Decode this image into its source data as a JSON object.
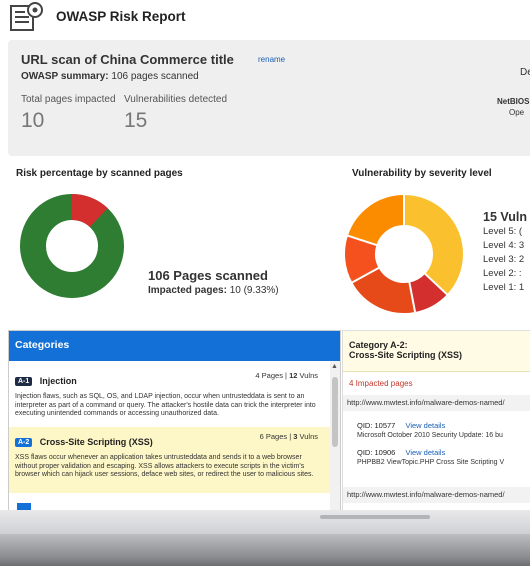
{
  "header": {
    "title": "OWASP Risk Report",
    "icon": "report-icon"
  },
  "scan": {
    "title": "URL scan of China Commerce title",
    "rename_label": "rename",
    "summary_label": "OWASP summary:",
    "summary_value": "106 pages scanned",
    "impacted_label": "Total pages impacted",
    "impacted_value": "10",
    "vuln_label": "Vulnerabilities detected",
    "vuln_value": "15",
    "right_frag_1": "De",
    "right_frag_2": "NetBIOS",
    "right_frag_3": "Ope"
  },
  "risk": {
    "title": "Risk percentage by scanned pages",
    "pages_scanned": "106 Pages scanned",
    "impacted_label": "Impacted pages:",
    "impacted_value": "10 (9.33%)",
    "donut": {
      "impacted_fraction": 0.0933,
      "impacted_color": "#d32f2f",
      "clean_color": "#2e7d32"
    }
  },
  "severity": {
    "title": "Vulnerability by severity level",
    "total_label": "15 Vuln",
    "levels": [
      "Level 5: (",
      "Level 4: 3",
      "Level 3: 2",
      "Level 2: :",
      "Level 1: 1"
    ],
    "colors": [
      "#d32f2f",
      "#e64a19",
      "#f4511e",
      "#fb8c00",
      "#fbc02d"
    ]
  },
  "categories": {
    "header": "Categories",
    "items": [
      {
        "badge": "A-1",
        "name": "Injection",
        "pages": "4",
        "pages_label": "Pages",
        "vulns": "12",
        "vulns_label": "Vulns",
        "desc": "Injection flaws, such as SQL, OS, and LDAP injection, occur when untrusteddata is sent to an interpreter as part of a command or query. The attacker's hostile data can trick the interpreter into executing unintended commands or accessing unauthorized data."
      },
      {
        "badge": "A-2",
        "name": "Cross-Site Scripting (XSS)",
        "pages": "6",
        "pages_label": "Pages",
        "vulns": "3",
        "vulns_label": "Vulns",
        "desc": "XSS flaws occur whenever an application takes untrusteddata and sends it to a web browser without proper validation and escaping. XSS allows attackers to execute scripts in the victim's browser which can hijack user sessions, deface web sites, or redirect the user to malicious sites."
      }
    ]
  },
  "detail": {
    "category": "Category A-2:",
    "name": "Cross-Site Scripting (XSS)",
    "impacted": "4 Impacted pages",
    "url1": "http://www.mwtest.info/malware-demos-named/",
    "qid1": "QID: 10577",
    "qid1_link": "View details",
    "qid1_desc": "Microsoft October 2010 Security Update: 16 bu",
    "qid2": "QID: 10906",
    "qid2_link": "View details",
    "qid2_desc": "PHPBB2 ViewTopic.PHP Cross Site Scripting V",
    "url2": "http://www.mwtest.info/malware-demos-named/"
  }
}
